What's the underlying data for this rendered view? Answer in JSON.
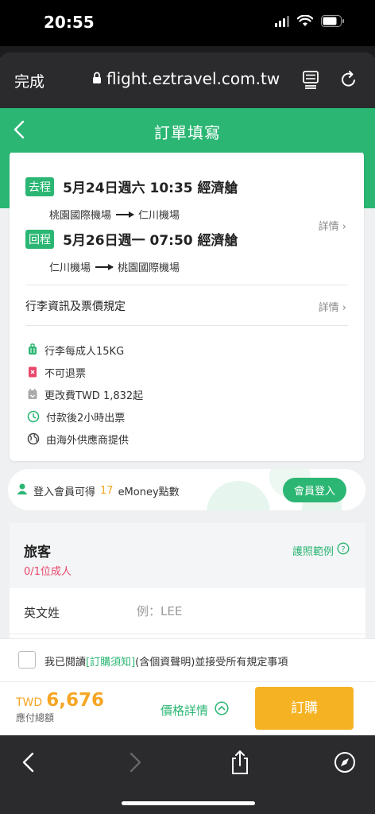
{
  "status": {
    "time": "20:55"
  },
  "browser": {
    "done_label": "完成",
    "url": "flight.eztravel.com.tw"
  },
  "header": {
    "title": "訂單填寫"
  },
  "trip": {
    "outbound": {
      "tag": "去程",
      "title": "5月24日週六 10:35 經濟艙",
      "from": "桃園國際機場",
      "to": "仁川機場"
    },
    "return": {
      "tag": "回程",
      "title": "5月26日週一 07:50 經濟艙",
      "from": "仁川機場",
      "to": "桃園國際機場"
    },
    "detail_label": "詳情",
    "baggage_title": "行李資訊及票價規定",
    "baggage_detail_label": "詳情",
    "info": [
      {
        "icon": "luggage-icon",
        "text": "行李每成人15KG"
      },
      {
        "icon": "no-refund-icon",
        "text": "不可退票"
      },
      {
        "icon": "change-fee-icon",
        "text": "更改費TWD 1,832起"
      },
      {
        "icon": "clock-icon",
        "text": "付款後2小時出票"
      },
      {
        "icon": "globe-icon",
        "text": "由海外供應商提供"
      }
    ]
  },
  "member": {
    "prefix": "登入會員可得",
    "amount": "17",
    "suffix": "eMoney點數",
    "login_label": "會員登入"
  },
  "traveler": {
    "title": "旅客",
    "count": "0/1位成人",
    "passport_label": "護照範例",
    "surname_label": "英文姓",
    "surname_placeholder": "例：LEE"
  },
  "agree": {
    "prefix": "我已閱讀",
    "link": "[訂購須知]",
    "suffix": "(含個資聲明)並接受所有規定事項"
  },
  "footer": {
    "currency": "TWD",
    "price": "6,676",
    "total_label": "應付總額",
    "detail_label": "價格詳情",
    "order_label": "訂購"
  },
  "colors": {
    "brand_green": "#2bb673",
    "accent_orange": "#f5a623",
    "warning_pink": "#e8466a"
  }
}
